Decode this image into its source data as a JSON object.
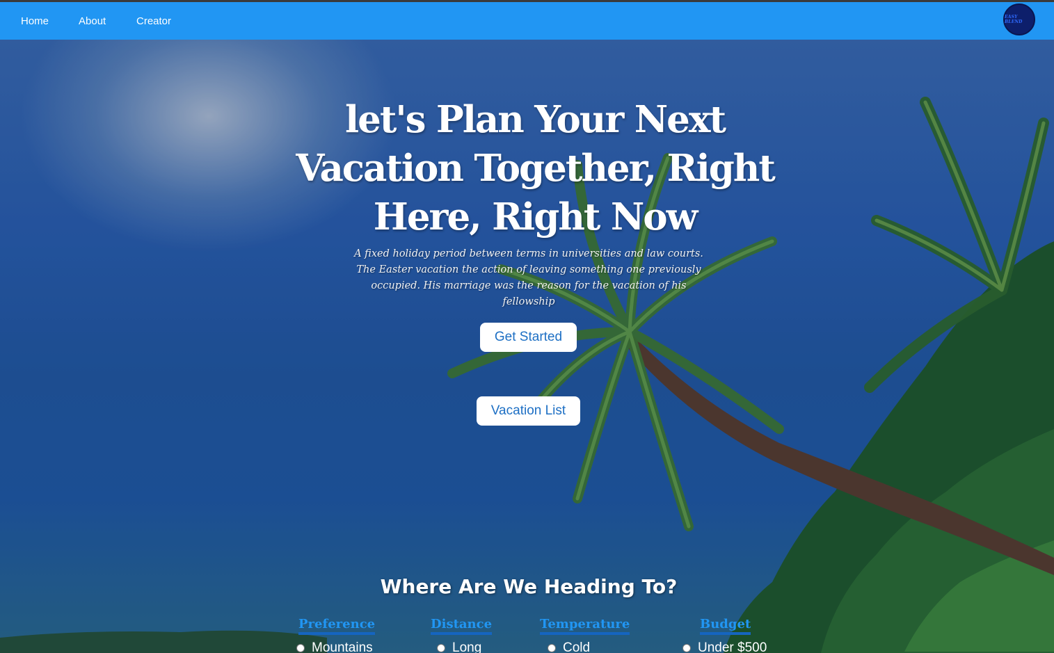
{
  "nav": {
    "items": [
      {
        "label": "Home"
      },
      {
        "label": "About"
      },
      {
        "label": "Creator"
      }
    ],
    "logo_text": "EASY BLEND"
  },
  "hero": {
    "title": "let's Plan Your Next Vacation Together, Right Here, Right Now",
    "subtitle": "A fixed holiday period between terms in universities and law courts. The Easter vacation the action of leaving something one previously occupied. His marriage was the reason for the vacation of his fellowship",
    "get_started_label": "Get Started",
    "vacation_list_label": "Vacation List"
  },
  "planner": {
    "heading": "Where Are We Heading To?",
    "columns": [
      {
        "title": "Preference",
        "first_option": "Mountains"
      },
      {
        "title": "Distance",
        "first_option": "Long"
      },
      {
        "title": "Temperature",
        "first_option": "Cold"
      },
      {
        "title": "Budget",
        "first_option": "Under $500"
      }
    ]
  },
  "colors": {
    "navbar": "#2196f3",
    "button_text": "#1d6fc4",
    "column_heading": "#2196f3"
  }
}
